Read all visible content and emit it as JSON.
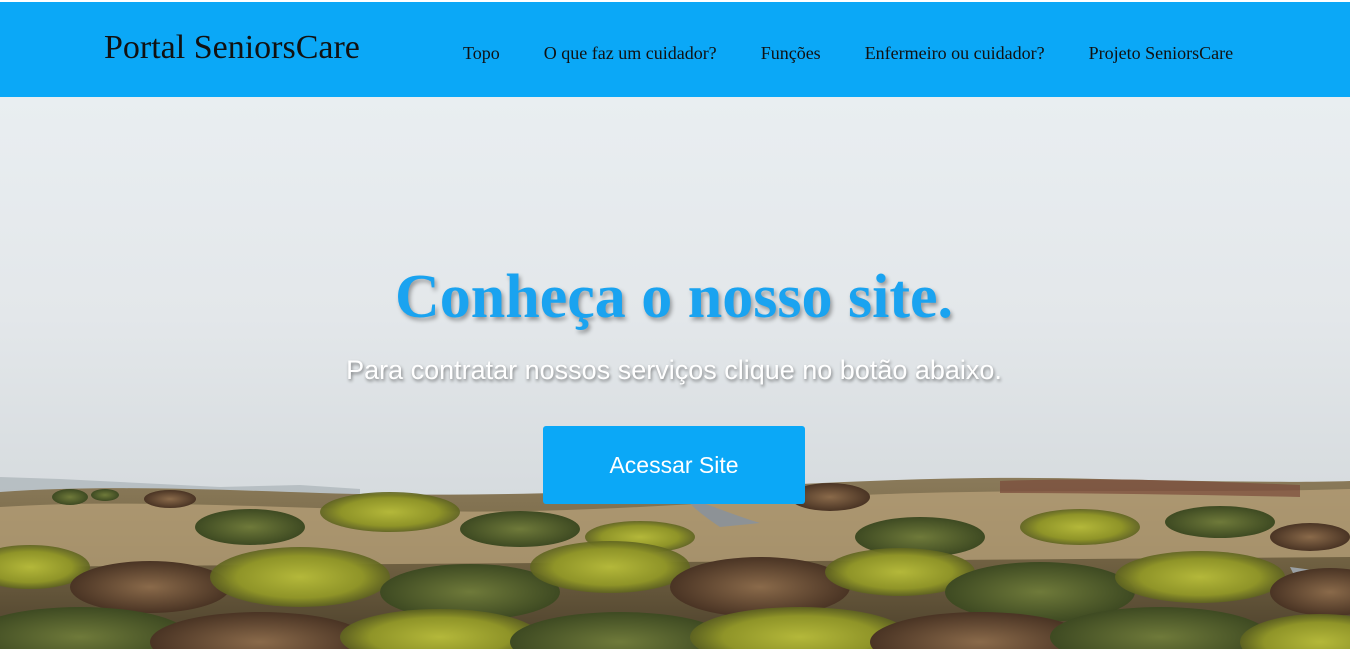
{
  "navbar": {
    "brand": "Portal SeniorsCare",
    "links": [
      {
        "label": "Topo"
      },
      {
        "label": "O que faz um cuidador?"
      },
      {
        "label": "Funções"
      },
      {
        "label": "Enfermeiro ou cuidador?"
      },
      {
        "label": "Projeto SeniorsCare"
      }
    ]
  },
  "hero": {
    "title": "Conheça o nosso site.",
    "subtitle": "Para contratar nossos serviços clique no botão abaixo.",
    "cta_label": "Acessar Site"
  },
  "colors": {
    "navbar_bg": "#0ba8f7",
    "title_color": "#1aa3f0",
    "button_bg": "#0ba8f7",
    "button_text": "#ffffff"
  }
}
